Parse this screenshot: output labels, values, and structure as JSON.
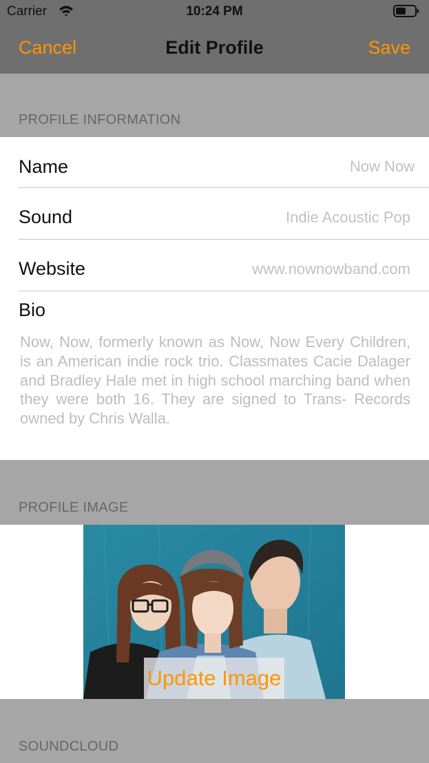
{
  "status_bar": {
    "carrier": "Carrier",
    "time": "10:24 PM"
  },
  "nav": {
    "cancel": "Cancel",
    "title": "Edit Profile",
    "save": "Save"
  },
  "accent_color": "#ff9500",
  "sections": {
    "profile_information": "PROFILE INFORMATION",
    "profile_image": "PROFILE IMAGE",
    "soundcloud": "SOUNDCLOUD"
  },
  "fields": {
    "name": {
      "label": "Name",
      "value": "Now Now"
    },
    "sound": {
      "label": "Sound",
      "value": "Indie Acoustic Pop"
    },
    "website": {
      "label": "Website",
      "value": "www.nownowband.com"
    },
    "bio": {
      "label": "Bio",
      "value": "Now, Now, formerly known as Now, Now Every Children, is an American indie rock trio. Classmates Cacie Dalager and Bradley Hale met in high school marching band when they were both 16. They are signed to Trans- Records owned by Chris Walla."
    }
  },
  "profile_image": {
    "update_label": "Update Image"
  }
}
